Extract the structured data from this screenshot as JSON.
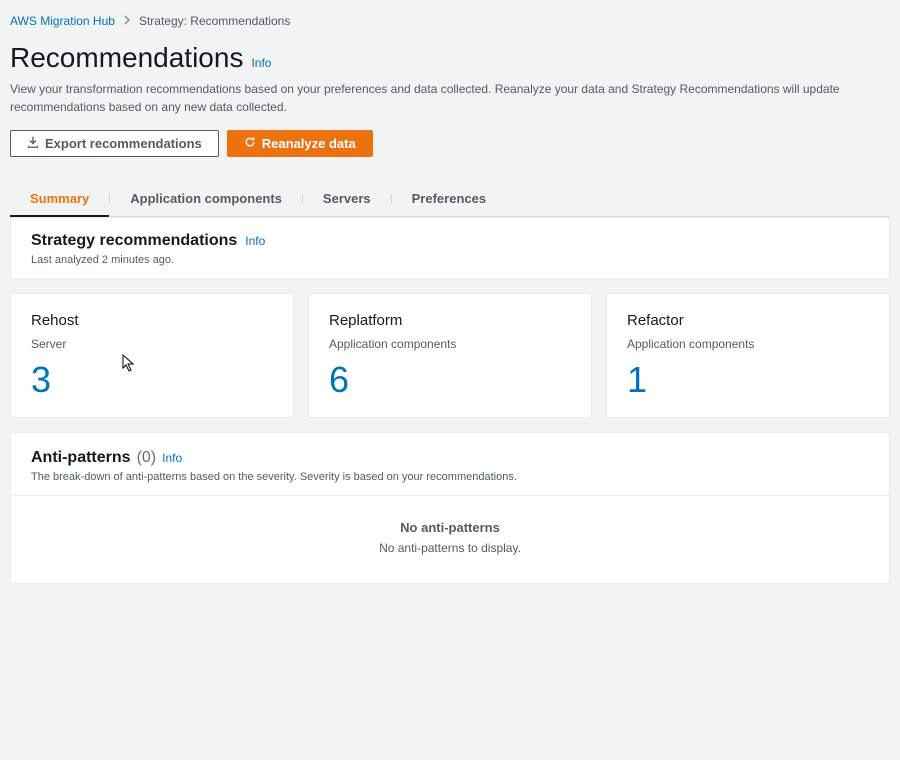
{
  "breadcrumb": {
    "root": "AWS Migration Hub",
    "current": "Strategy: Recommendations"
  },
  "header": {
    "title": "Recommendations",
    "info": "Info",
    "description": "View your transformation recommendations based on your preferences and data collected. Reanalyze your data and Strategy Recommendations will update recommendations based on any new data collected."
  },
  "actions": {
    "export": "Export recommendations",
    "reanalyze": "Reanalyze data"
  },
  "tabs": {
    "summary": "Summary",
    "appComponents": "Application components",
    "servers": "Servers",
    "preferences": "Preferences"
  },
  "strategy": {
    "title": "Strategy recommendations",
    "info": "Info",
    "lastAnalyzed": "Last analyzed 2 minutes ago."
  },
  "cards": [
    {
      "title": "Rehost",
      "subtitle": "Server",
      "count": "3"
    },
    {
      "title": "Replatform",
      "subtitle": "Application components",
      "count": "6"
    },
    {
      "title": "Refactor",
      "subtitle": "Application components",
      "count": "1"
    }
  ],
  "antiPatterns": {
    "title": "Anti-patterns",
    "count": "(0)",
    "info": "Info",
    "description": "The break-down of anti-patterns based on the severity. Severity is based on your recommendations.",
    "emptyTitle": "No anti-patterns",
    "emptyDesc": "No anti-patterns to display."
  }
}
